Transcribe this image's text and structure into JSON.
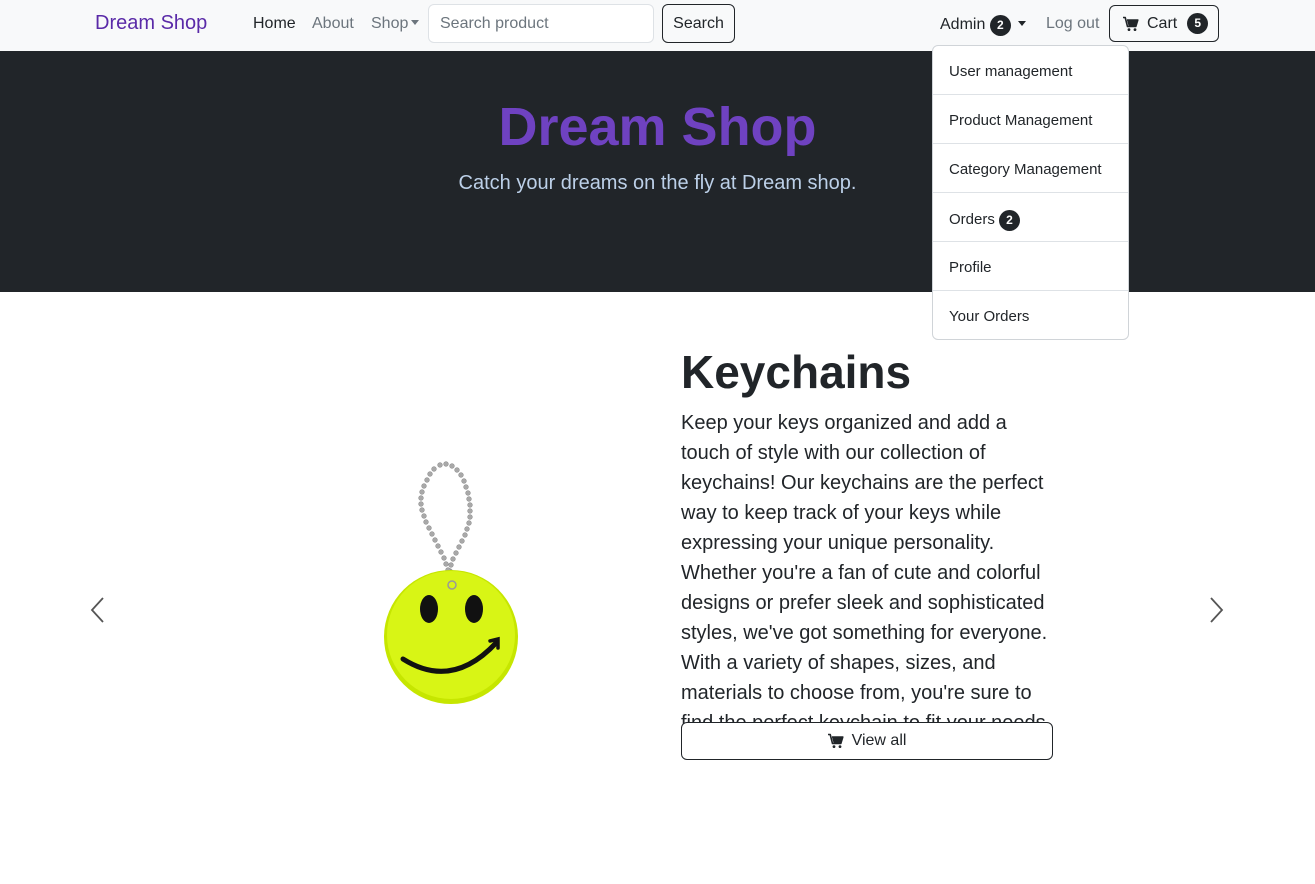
{
  "navbar": {
    "brand": "Dream Shop",
    "links": {
      "home": "Home",
      "about": "About",
      "shop": "Shop"
    },
    "search": {
      "placeholder": "Search product",
      "button": "Search"
    },
    "admin": {
      "label": "Admin",
      "badge": "2"
    },
    "logout": "Log out",
    "cart": {
      "label": "Cart",
      "badge": "5"
    }
  },
  "hero": {
    "title": "Dream Shop",
    "subtitle": "Catch your dreams on the fly at Dream shop."
  },
  "admin_menu": {
    "items": [
      {
        "label": "User management"
      },
      {
        "label": "Product Management"
      },
      {
        "label": "Category Management"
      },
      {
        "label": "Orders",
        "badge": "2"
      },
      {
        "label": "Profile"
      },
      {
        "label": "Your Orders"
      }
    ]
  },
  "carousel": {
    "title": "Keychains",
    "description": "Keep your keys organized and add a touch of style with our collection of keychains! Our keychains are the perfect way to keep track of your keys while expressing your unique personality. Whether you're a fan of cute and colorful designs or prefer sleek and sophisticated styles, we've got something for everyone. With a variety of shapes, sizes, and materials to choose from, you're sure to find the perfect keychain to fit your needs.",
    "button": "View all"
  },
  "colors": {
    "brand": "#5a2aa8",
    "hero_title": "#6f42c1",
    "hero_bg": "#212529",
    "navbar_bg": "#f8f9fa",
    "smiley": "#d4f000"
  },
  "icons": [
    "cart-icon",
    "chevron-left-icon",
    "chevron-right-icon",
    "caret-down-icon"
  ]
}
